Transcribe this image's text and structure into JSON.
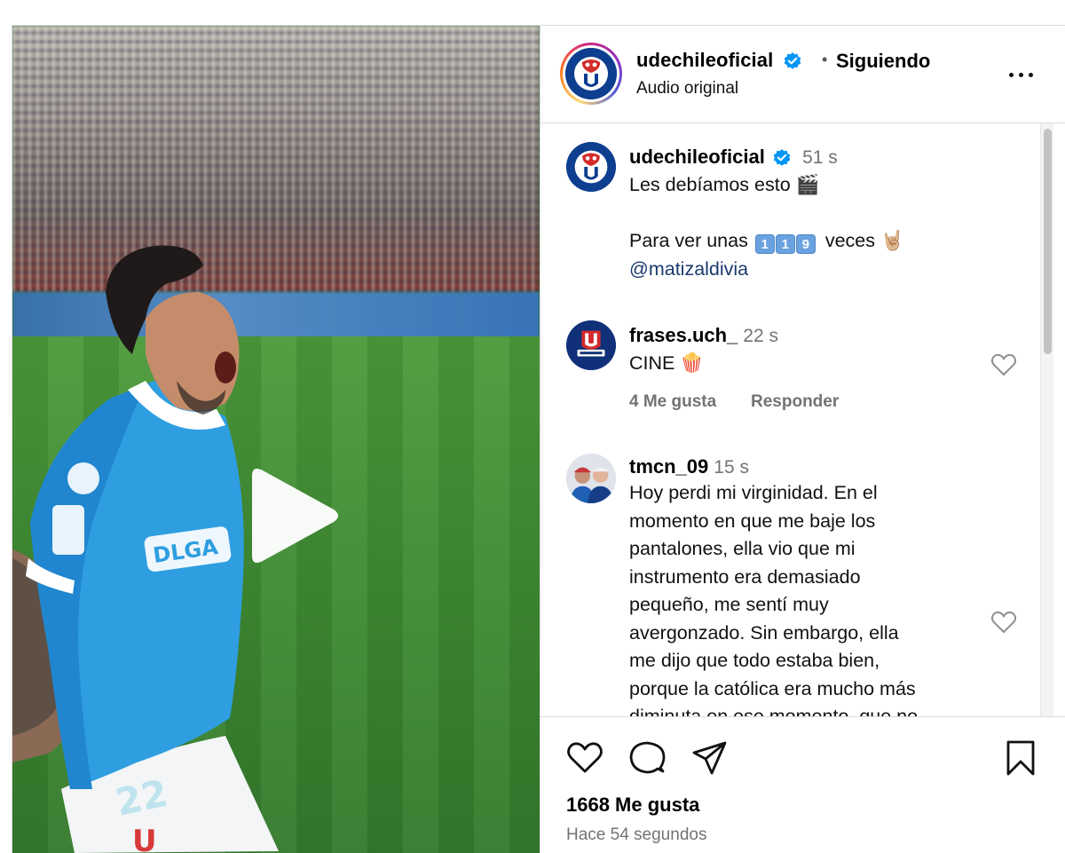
{
  "post": {
    "username": "udechileoficial",
    "follow_status": "Siguiendo",
    "separator": "•",
    "audio": "Audio original",
    "verified": true
  },
  "comments": [
    {
      "username": "udechileoficial",
      "time": "51 s",
      "line1": "Les debíamos esto",
      "line1_emoji": "🎬",
      "line2_prefix": "Para ver unas",
      "line2_keys": [
        "1",
        "1",
        "9"
      ],
      "line2_suffix": "veces",
      "line2_emoji": "🤘🏼",
      "mention": "@matizaldivia",
      "verified": true
    },
    {
      "username": "frases.uch_",
      "time": "22 s",
      "text": "CINE",
      "emoji": "🍿",
      "likes": "4 Me gusta",
      "reply": "Responder"
    },
    {
      "username": "tmcn_09",
      "time": "15 s",
      "lines": [
        "Hoy perdi mi virginidad. En el",
        "momento en que me baje los",
        "pantalones, ella vio que mi",
        "instrumento era demasiado",
        "pequeño, me sentí muy",
        "avergonzado. Sin embargo, ella",
        "me dijo que todo estaba bien,",
        "porque la católica era mucho más",
        "diminuta en ese momento, que no"
      ]
    }
  ],
  "footer": {
    "likes": "1668 Me gusta",
    "time_ago": "Hace 54 segundos"
  },
  "colors": {
    "verified": "#0095f6",
    "club_blue": "#0d3e8f",
    "muted_text": "#737373",
    "border": "#dbdbdb"
  },
  "icons": {
    "play": "play-icon",
    "more": "more-options-icon",
    "like": "heart-icon",
    "comment": "comment-icon",
    "share": "share-icon",
    "save": "bookmark-icon"
  }
}
